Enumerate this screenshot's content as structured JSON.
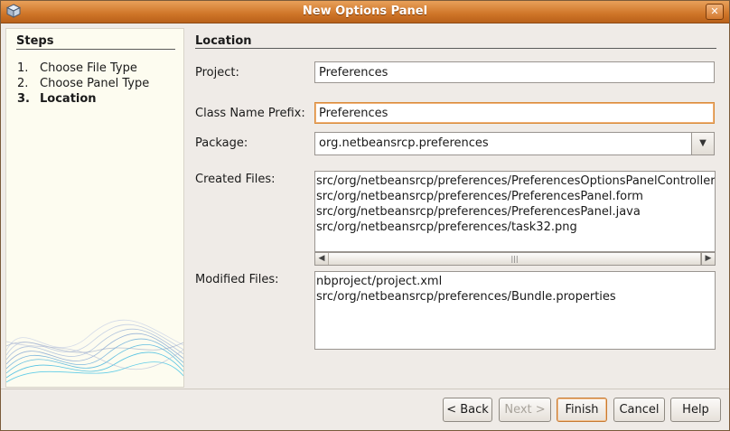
{
  "window": {
    "title": "New Options Panel"
  },
  "steps": {
    "title": "Steps",
    "items": [
      {
        "num": "1.",
        "label": "Choose File Type"
      },
      {
        "num": "2.",
        "label": "Choose Panel Type"
      },
      {
        "num": "3.",
        "label": "Location"
      }
    ],
    "current_index": 2
  },
  "content": {
    "title": "Location",
    "project": {
      "label": "Project:",
      "value": "Preferences"
    },
    "class_name_prefix": {
      "label": "Class Name Prefix:",
      "value": "Preferences"
    },
    "package": {
      "label": "Package:",
      "value": "org.netbeansrcp.preferences"
    },
    "created_files": {
      "label": "Created Files:",
      "lines": [
        "src/org/netbeansrcp/preferences/PreferencesOptionsPanelController.java",
        "src/org/netbeansrcp/preferences/PreferencesPanel.form",
        "src/org/netbeansrcp/preferences/PreferencesPanel.java",
        "src/org/netbeansrcp/preferences/task32.png"
      ]
    },
    "modified_files": {
      "label": "Modified Files:",
      "lines": [
        "nbproject/project.xml",
        "src/org/netbeansrcp/preferences/Bundle.properties"
      ]
    }
  },
  "buttons": {
    "back": "< Back",
    "next": "Next >",
    "finish": "Finish",
    "cancel": "Cancel",
    "help": "Help"
  }
}
